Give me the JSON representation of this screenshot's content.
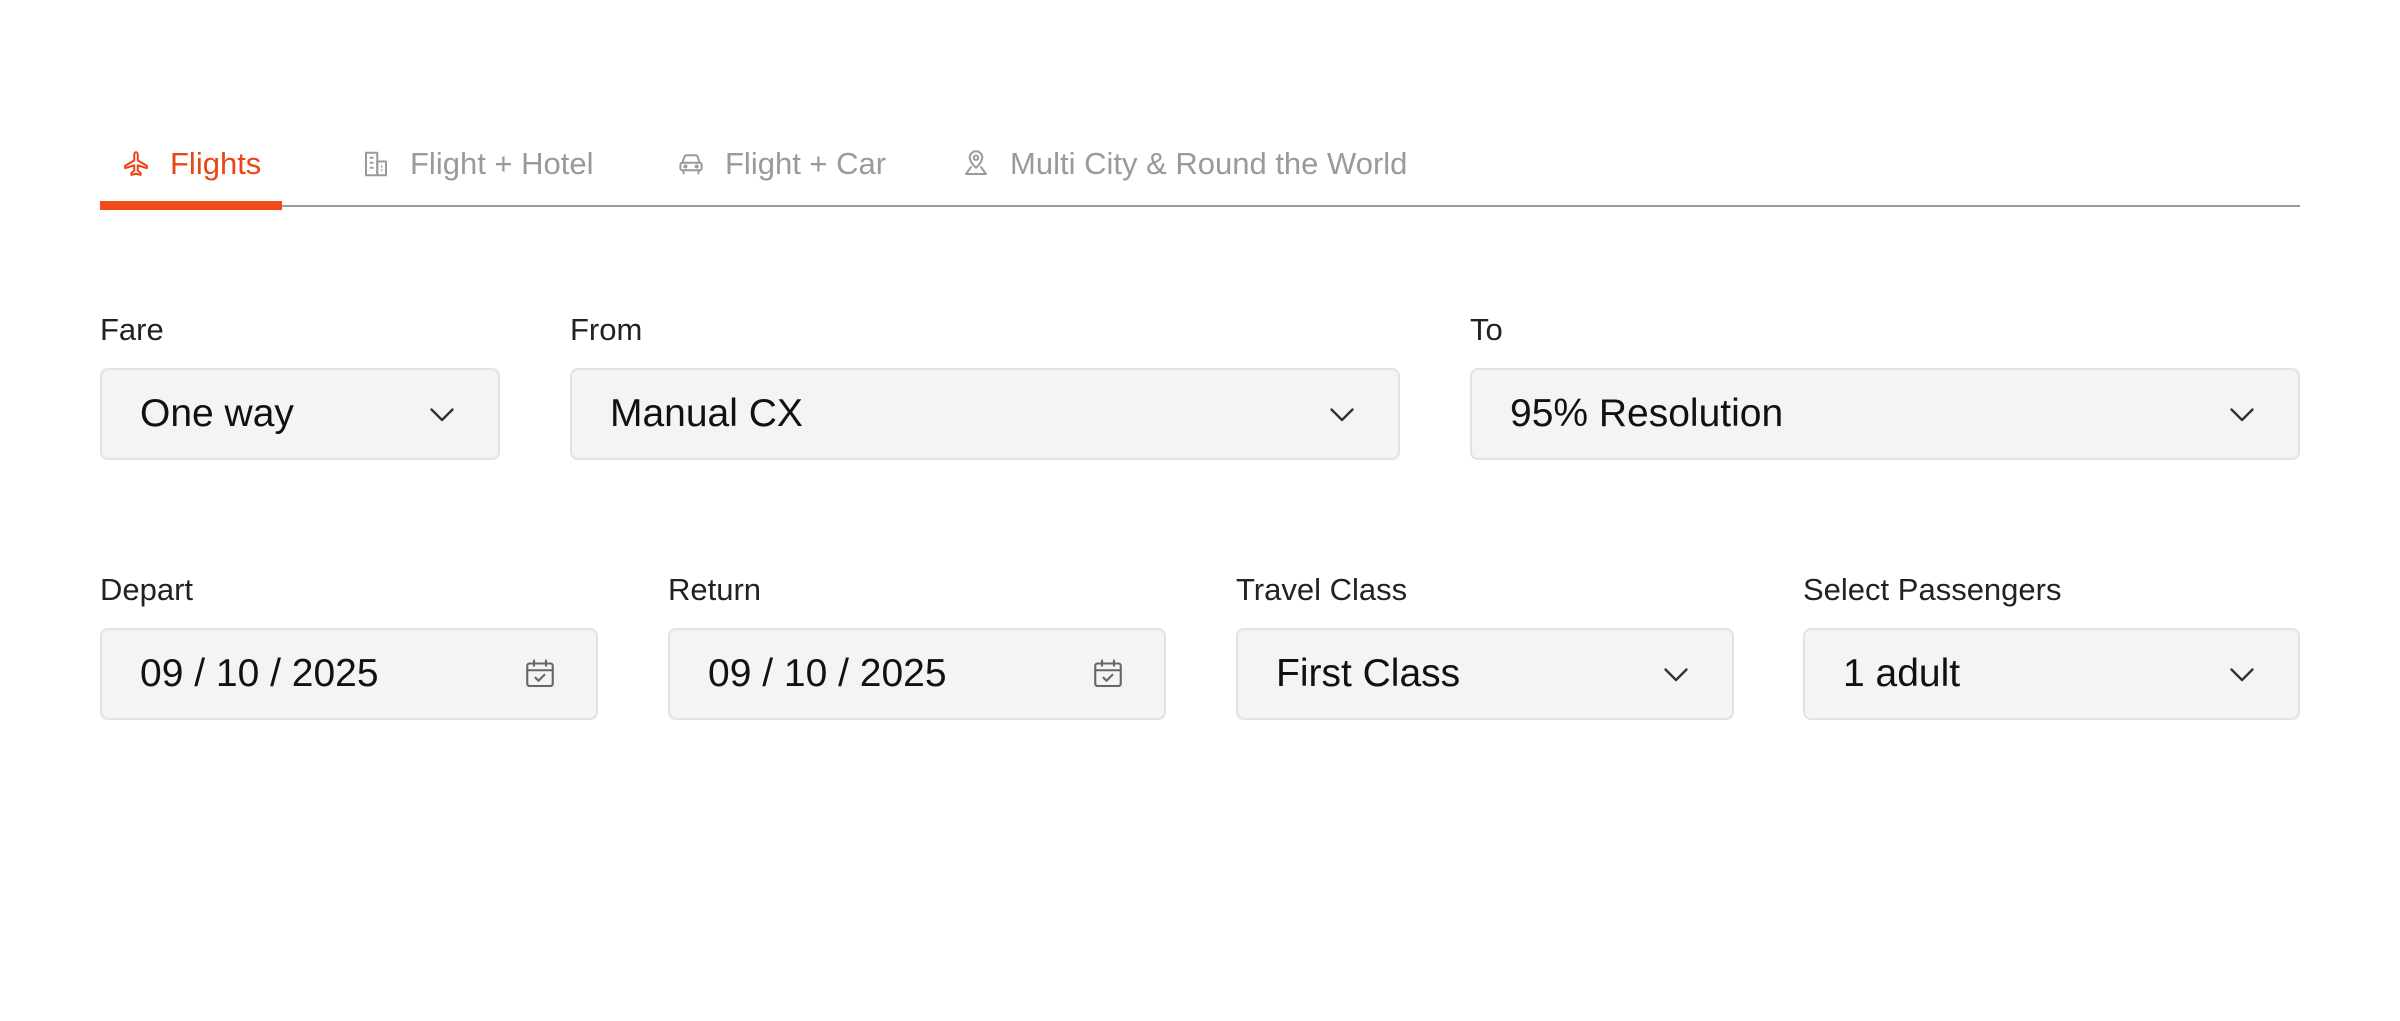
{
  "tabs": [
    {
      "label": "Flights",
      "icon": "plane-icon",
      "active": true
    },
    {
      "label": "Flight + Hotel",
      "icon": "building-icon",
      "active": false
    },
    {
      "label": "Flight + Car",
      "icon": "car-icon",
      "active": false
    },
    {
      "label": "Multi City & Round the World",
      "icon": "map-pin-icon",
      "active": false
    }
  ],
  "form": {
    "fare": {
      "label": "Fare",
      "value": "One way",
      "icon": "chevron-down-icon"
    },
    "from": {
      "label": "From",
      "value": "Manual CX",
      "icon": "chevron-down-icon"
    },
    "to": {
      "label": "To",
      "value": "95% Resolution",
      "icon": "chevron-down-icon"
    },
    "depart": {
      "label": "Depart",
      "value": "09 / 10 / 2025",
      "icon": "calendar-icon"
    },
    "return": {
      "label": "Return",
      "value": "09 / 10 / 2025",
      "icon": "calendar-icon"
    },
    "travel_class": {
      "label": "Travel Class",
      "value": "First Class",
      "icon": "chevron-down-icon"
    },
    "passengers": {
      "label": "Select Passengers",
      "value": "1 adult",
      "icon": "chevron-down-icon"
    }
  },
  "colors": {
    "accent": "#f24a18",
    "inactive_tab": "#9a9a9a",
    "field_bg": "#f4f4f4",
    "field_border": "#e2e2e2"
  }
}
